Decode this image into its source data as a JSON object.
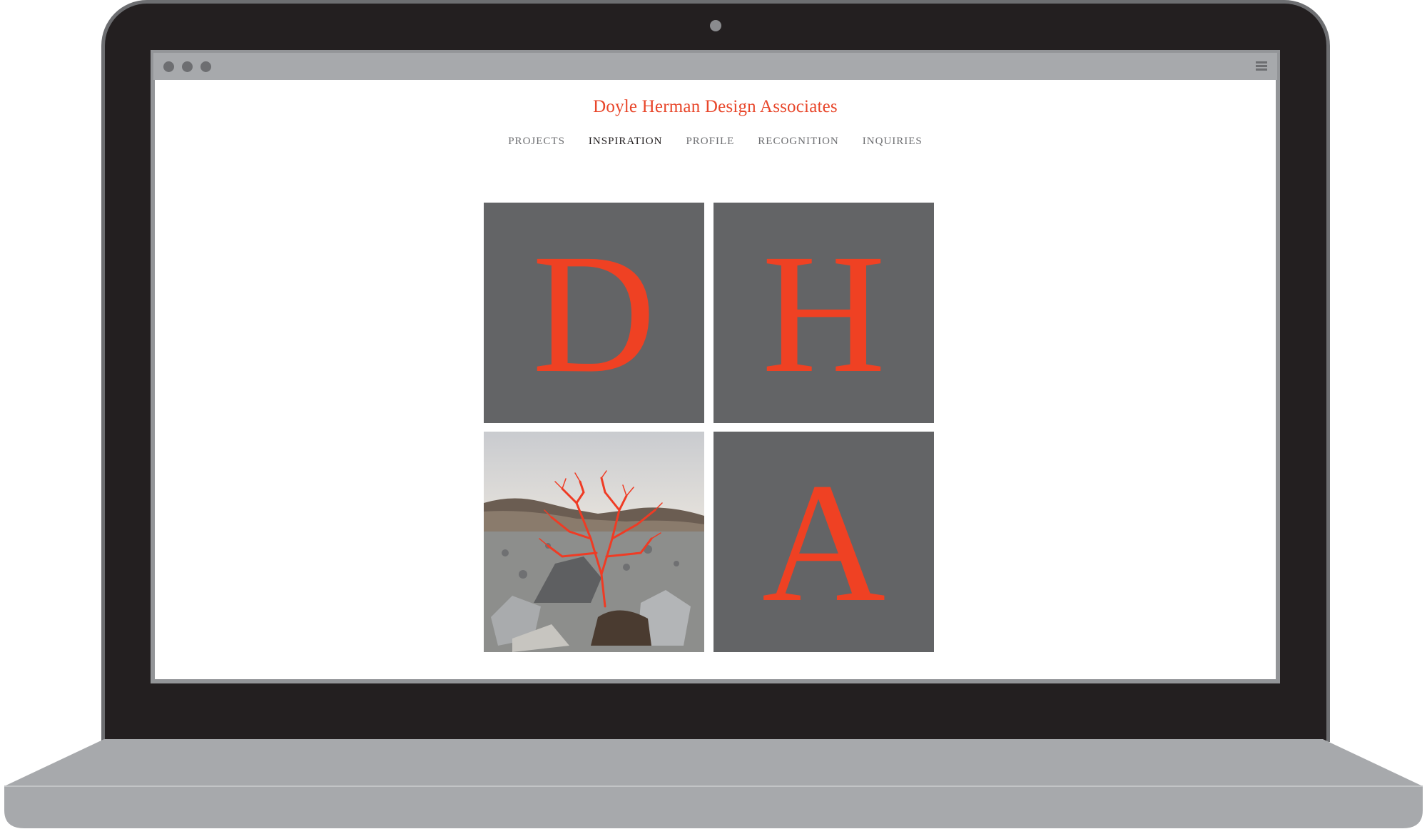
{
  "browser": {
    "menu_icon": "hamburger-icon"
  },
  "site": {
    "title": "Doyle Herman Design Associates"
  },
  "nav": {
    "items": [
      {
        "label": "PROJECTS",
        "active": false
      },
      {
        "label": "INSPIRATION",
        "active": true
      },
      {
        "label": "PROFILE",
        "active": false
      },
      {
        "label": "RECOGNITION",
        "active": false
      },
      {
        "label": "INQUIRIES",
        "active": false
      }
    ]
  },
  "tiles": {
    "d": "D",
    "h": "H",
    "a": "A",
    "photo_icon": "desert-red-shrub-photo"
  },
  "colors": {
    "accent": "#ef4123",
    "tile": "#636466",
    "bezel": "#231f20",
    "base": "#a7a9ac"
  }
}
